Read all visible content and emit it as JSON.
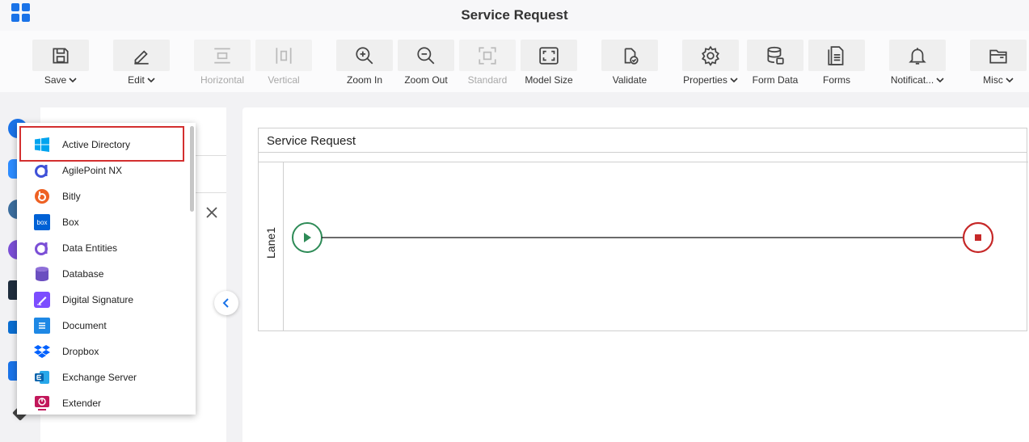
{
  "header": {
    "title": "Service Request"
  },
  "toolbar": {
    "save": "Save",
    "edit": "Edit",
    "horizontal": "Horizontal",
    "vertical": "Vertical",
    "zoom_in": "Zoom In",
    "zoom_out": "Zoom Out",
    "standard": "Standard",
    "model_size": "Model Size",
    "validate": "Validate",
    "properties": "Properties",
    "form_data": "Form Data",
    "forms": "Forms",
    "notifications": "Notificat...",
    "misc": "Misc"
  },
  "canvas": {
    "pool_title": "Service Request",
    "lane_label": "Lane1"
  },
  "dropdown": {
    "items": [
      {
        "label": "Active Directory",
        "icon": "windows-icon",
        "color": "#00a4ef"
      },
      {
        "label": "AgilePoint NX",
        "icon": "agilepoint-icon",
        "color": "#3f51d8"
      },
      {
        "label": "Bitly",
        "icon": "bitly-icon",
        "color": "#ee6123"
      },
      {
        "label": "Box",
        "icon": "box-icon",
        "color": "#0061d5"
      },
      {
        "label": "Data Entities",
        "icon": "data-entities-icon",
        "color": "#7b4fd6"
      },
      {
        "label": "Database",
        "icon": "database-icon",
        "color": "#6b4fc0"
      },
      {
        "label": "Digital Signature",
        "icon": "digital-signature-icon",
        "color": "#7c4dff"
      },
      {
        "label": "Document",
        "icon": "document-icon",
        "color": "#1e88e5"
      },
      {
        "label": "Dropbox",
        "icon": "dropbox-icon",
        "color": "#0061fe"
      },
      {
        "label": "Exchange Server",
        "icon": "exchange-icon",
        "color": "#0a64ad"
      },
      {
        "label": "Extender",
        "icon": "extender-icon",
        "color": "#c2185b"
      }
    ]
  },
  "colors": {
    "accent": "#1a73e8",
    "start_event": "#2e8b57",
    "end_event": "#c62828",
    "highlight": "#d32f2f"
  }
}
